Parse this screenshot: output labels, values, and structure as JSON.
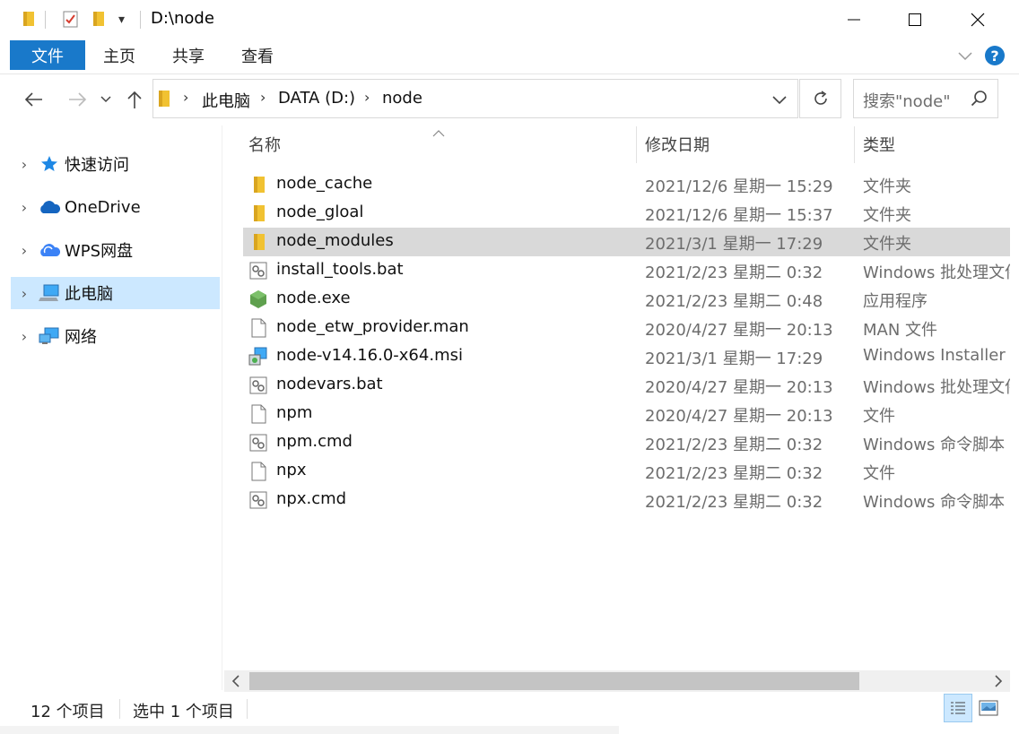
{
  "window": {
    "title": "D:\\node",
    "colors": {
      "accent": "#1979ca",
      "selection": "#cce8ff",
      "row_selected": "#d9d9d9",
      "help": "#1979ca"
    }
  },
  "ribbon": {
    "tabs": [
      {
        "label": "文件",
        "active": true
      },
      {
        "label": "主页",
        "active": false
      },
      {
        "label": "共享",
        "active": false
      },
      {
        "label": "查看",
        "active": false
      }
    ]
  },
  "address": {
    "crumbs": [
      "此电脑",
      "DATA (D:)",
      "node"
    ],
    "search_placeholder": "搜索\"node\""
  },
  "nav": {
    "items": [
      {
        "label": "快速访问",
        "icon": "star-icon",
        "selected": false
      },
      {
        "label": "OneDrive",
        "icon": "cloud-icon",
        "selected": false
      },
      {
        "label": "WPS网盘",
        "icon": "wps-cloud-icon",
        "selected": false
      },
      {
        "label": "此电脑",
        "icon": "computer-icon",
        "selected": true
      },
      {
        "label": "网络",
        "icon": "network-icon",
        "selected": false
      }
    ]
  },
  "columns": {
    "name": "名称",
    "date": "修改日期",
    "type": "类型"
  },
  "files": [
    {
      "name": "node_cache",
      "date": "2021/12/6 星期一 15:29",
      "type": "文件夹",
      "icon": "folder-icon",
      "selected": false
    },
    {
      "name": "node_gloal",
      "date": "2021/12/6 星期一 15:37",
      "type": "文件夹",
      "icon": "folder-icon",
      "selected": false
    },
    {
      "name": "node_modules",
      "date": "2021/3/1 星期一 17:29",
      "type": "文件夹",
      "icon": "folder-icon",
      "selected": true
    },
    {
      "name": "install_tools.bat",
      "date": "2021/2/23 星期二 0:32",
      "type": "Windows 批处理文件",
      "icon": "batch-file-icon",
      "selected": false
    },
    {
      "name": "node.exe",
      "date": "2021/2/23 星期二 0:48",
      "type": "应用程序",
      "icon": "node-exe-icon",
      "selected": false
    },
    {
      "name": "node_etw_provider.man",
      "date": "2020/4/27 星期一 20:13",
      "type": "MAN 文件",
      "icon": "file-icon",
      "selected": false
    },
    {
      "name": "node-v14.16.0-x64.msi",
      "date": "2021/3/1 星期一 17:29",
      "type": "Windows Installer ...",
      "icon": "installer-icon",
      "selected": false
    },
    {
      "name": "nodevars.bat",
      "date": "2020/4/27 星期一 20:13",
      "type": "Windows 批处理文件",
      "icon": "batch-file-icon",
      "selected": false
    },
    {
      "name": "npm",
      "date": "2020/4/27 星期一 20:13",
      "type": "文件",
      "icon": "file-icon",
      "selected": false
    },
    {
      "name": "npm.cmd",
      "date": "2021/2/23 星期二 0:32",
      "type": "Windows 命令脚本",
      "icon": "batch-file-icon",
      "selected": false
    },
    {
      "name": "npx",
      "date": "2021/2/23 星期二 0:32",
      "type": "文件",
      "icon": "file-icon",
      "selected": false
    },
    {
      "name": "npx.cmd",
      "date": "2021/2/23 星期二 0:32",
      "type": "Windows 命令脚本",
      "icon": "batch-file-icon",
      "selected": false
    }
  ],
  "status": {
    "item_count": "12 个项目",
    "selected_count": "选中 1 个项目"
  }
}
